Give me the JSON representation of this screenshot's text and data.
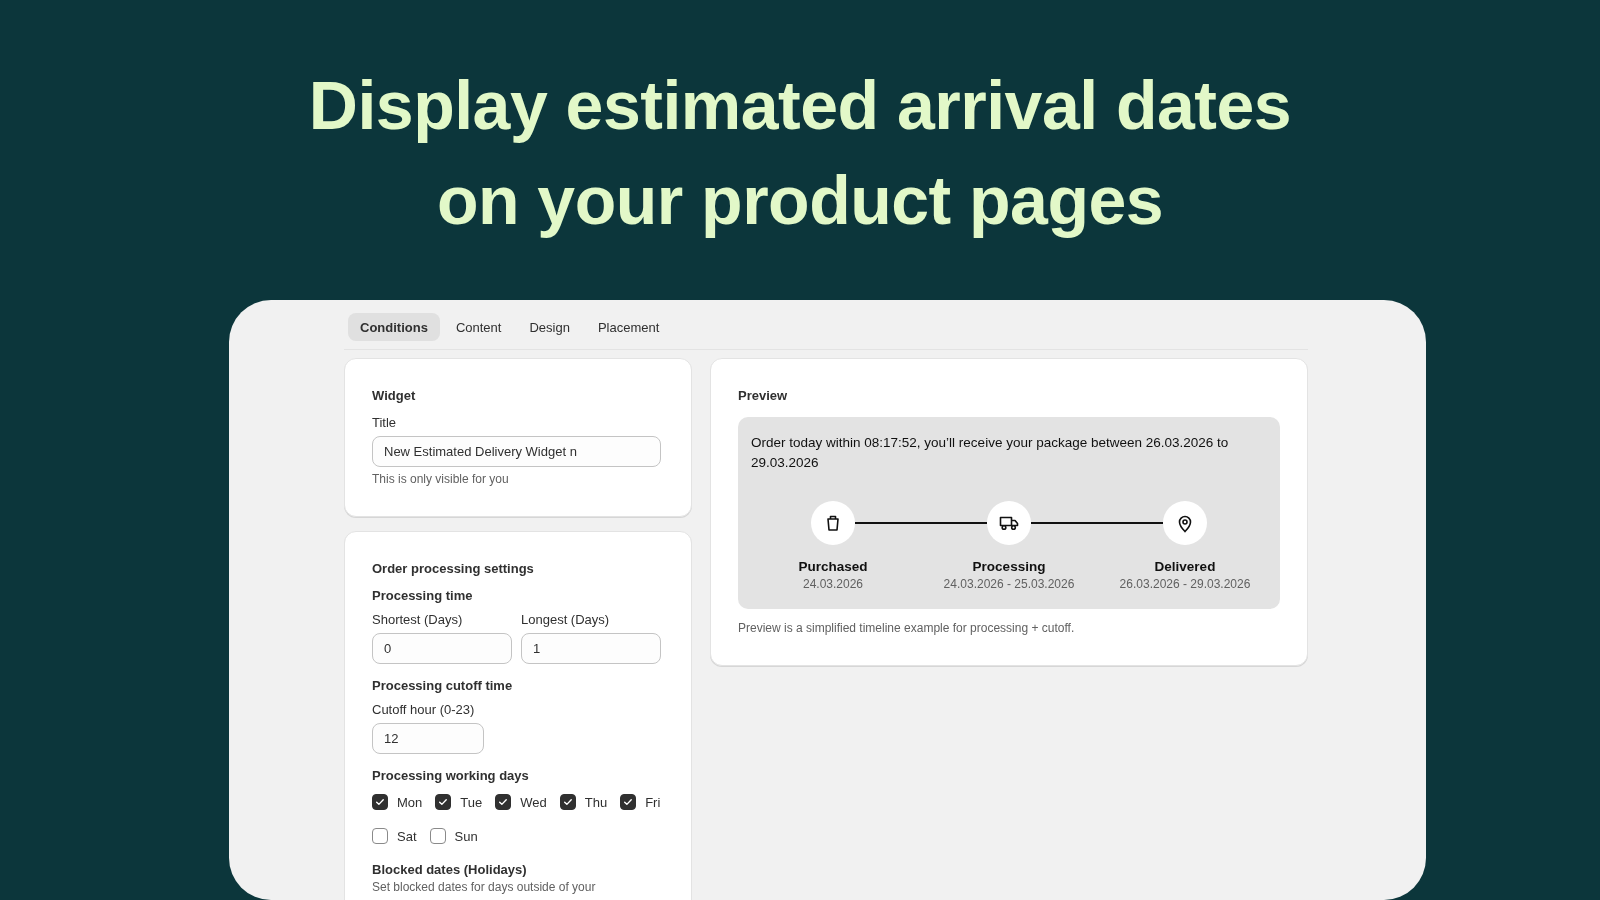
{
  "headline_lines": [
    "Display estimated arrival dates",
    "on your product pages"
  ],
  "tabs": [
    {
      "label": "Conditions",
      "selected": true
    },
    {
      "label": "Content",
      "selected": false
    },
    {
      "label": "Design",
      "selected": false
    },
    {
      "label": "Placement",
      "selected": false
    }
  ],
  "widget_card": {
    "heading": "Widget",
    "title_label": "Title",
    "title_value": "New Estimated Delivery Widget n",
    "help": "This is only visible for you"
  },
  "processing_card": {
    "heading": "Order processing settings",
    "processing_time_heading": "Processing time",
    "shortest_label": "Shortest (Days)",
    "shortest_value": "0",
    "longest_label": "Longest (Days)",
    "longest_value": "1",
    "cutoff_heading": "Processing cutoff time",
    "cutoff_label": "Cutoff hour (0-23)",
    "cutoff_value": "12",
    "working_days_heading": "Processing working days",
    "days": [
      {
        "label": "Mon",
        "checked": true
      },
      {
        "label": "Tue",
        "checked": true
      },
      {
        "label": "Wed",
        "checked": true
      },
      {
        "label": "Thu",
        "checked": true
      },
      {
        "label": "Fri",
        "checked": true
      },
      {
        "label": "Sat",
        "checked": false
      },
      {
        "label": "Sun",
        "checked": false
      }
    ],
    "blocked_heading": "Blocked dates (Holidays)",
    "blocked_help": "Set blocked dates for days outside of your"
  },
  "preview_card": {
    "heading": "Preview",
    "message": "Order today within 08:17:52, you’ll receive your package between 26.03.2026 to 29.03.2026",
    "steps": [
      {
        "kind": "bag",
        "label": "Purchased",
        "date": "24.03.2026"
      },
      {
        "kind": "truck",
        "label": "Processing",
        "date": "24.03.2026 - 25.03.2026"
      },
      {
        "kind": "pin",
        "label": "Delivered",
        "date": "26.03.2026 - 29.03.2026"
      }
    ],
    "note": "Preview is a simplified timeline example for processing + cutoff."
  }
}
